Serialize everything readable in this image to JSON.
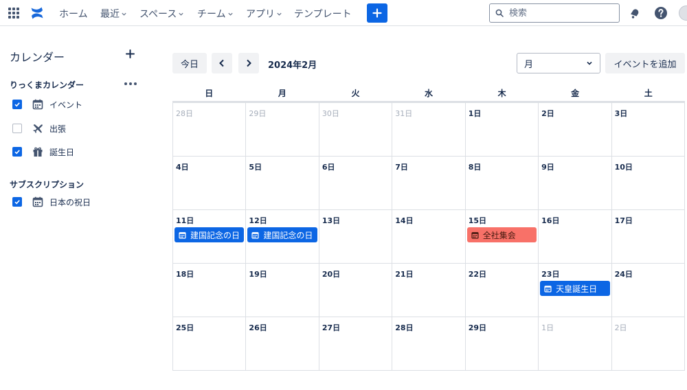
{
  "nav": {
    "items": [
      {
        "label": "ホーム",
        "dropdown": false
      },
      {
        "label": "最近",
        "dropdown": true
      },
      {
        "label": "スペース",
        "dropdown": true
      },
      {
        "label": "チーム",
        "dropdown": true
      },
      {
        "label": "アプリ",
        "dropdown": true
      },
      {
        "label": "テンプレート",
        "dropdown": false
      }
    ],
    "search_placeholder": "検索",
    "icons": [
      "app-switcher-icon",
      "confluence-logo-icon",
      "plus-icon",
      "search-icon",
      "notification-bell-icon",
      "help-icon",
      "avatar"
    ]
  },
  "sidebar": {
    "title": "カレンダー",
    "my_calendars": {
      "heading": "りっくまカレンダー",
      "items": [
        {
          "label": "イベント",
          "checked": true,
          "icon": "calendar-icon"
        },
        {
          "label": "出張",
          "checked": false,
          "icon": "airplane-icon"
        },
        {
          "label": "誕生日",
          "checked": true,
          "icon": "gift-icon"
        }
      ]
    },
    "subscriptions": {
      "heading": "サブスクリプション",
      "items": [
        {
          "label": "日本の祝日",
          "checked": true,
          "icon": "calendar-icon"
        }
      ]
    }
  },
  "toolbar": {
    "today_label": "今日",
    "month_label": "2024年2月",
    "view_value": "月",
    "add_event_label": "イベントを追加"
  },
  "calendar": {
    "weekdays": [
      "日",
      "月",
      "火",
      "水",
      "木",
      "金",
      "土"
    ],
    "weeks": [
      [
        {
          "label": "28日",
          "other": true
        },
        {
          "label": "29日",
          "other": true
        },
        {
          "label": "30日",
          "other": true
        },
        {
          "label": "31日",
          "other": true
        },
        {
          "label": "1日",
          "other": false
        },
        {
          "label": "2日",
          "other": false
        },
        {
          "label": "3日",
          "other": false
        }
      ],
      [
        {
          "label": "4日",
          "other": false
        },
        {
          "label": "5日",
          "other": false
        },
        {
          "label": "6日",
          "other": false
        },
        {
          "label": "7日",
          "other": false
        },
        {
          "label": "8日",
          "other": false
        },
        {
          "label": "9日",
          "other": false
        },
        {
          "label": "10日",
          "other": false
        }
      ],
      [
        {
          "label": "11日",
          "other": false,
          "event": {
            "label": "建国記念の日",
            "style": "holiday"
          }
        },
        {
          "label": "12日",
          "other": false,
          "event": {
            "label": "建国記念の日",
            "style": "holiday"
          }
        },
        {
          "label": "13日",
          "other": false
        },
        {
          "label": "14日",
          "other": false
        },
        {
          "label": "15日",
          "other": false,
          "event": {
            "label": "全社集会",
            "style": "company"
          }
        },
        {
          "label": "16日",
          "other": false
        },
        {
          "label": "17日",
          "other": false
        }
      ],
      [
        {
          "label": "18日",
          "other": false
        },
        {
          "label": "19日",
          "other": false
        },
        {
          "label": "20日",
          "other": false
        },
        {
          "label": "21日",
          "other": false
        },
        {
          "label": "22日",
          "other": false
        },
        {
          "label": "23日",
          "other": false,
          "event": {
            "label": "天皇誕生日",
            "style": "holiday"
          }
        },
        {
          "label": "24日",
          "other": false
        }
      ],
      [
        {
          "label": "25日",
          "other": false
        },
        {
          "label": "26日",
          "other": false
        },
        {
          "label": "27日",
          "other": false
        },
        {
          "label": "28日",
          "other": false
        },
        {
          "label": "29日",
          "other": false
        },
        {
          "label": "1日",
          "other": true
        },
        {
          "label": "2日",
          "other": true
        }
      ]
    ],
    "event_styles": {
      "holiday": {
        "bg": "#0c66e4",
        "fg": "#ffffff"
      },
      "company": {
        "bg": "#f87168",
        "fg": "#44190f"
      }
    }
  },
  "colors": {
    "accent": "#0c66e4",
    "text": "#172b4d",
    "muted_text": "#a5adba",
    "border": "#dcdfe4"
  }
}
